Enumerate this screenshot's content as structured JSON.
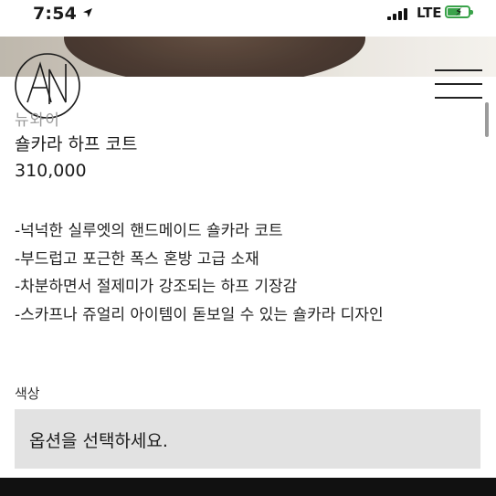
{
  "status": {
    "time": "7:54",
    "network": "LTE",
    "battery_color": "#3aa34a"
  },
  "header": {
    "logo_icon": "brand-monogram-icon",
    "menu_icon": "hamburger-menu-icon"
  },
  "product": {
    "brand": "뉴와이",
    "name": "숄카라 하프 코트",
    "price": "310,000",
    "description": [
      "-넉넉한 실루엣의 핸드메이드 숄카라 코트",
      "-부드럽고 포근한 폭스 혼방 고급 소재",
      "-차분하면서 절제미가 강조되는 하프 기장감",
      "-스카프나 쥬얼리 아이템이 돋보일 수 있는 숄카라 디자인"
    ]
  },
  "options": {
    "color_label": "색상",
    "color_placeholder": "옵션을 선택하세요."
  }
}
